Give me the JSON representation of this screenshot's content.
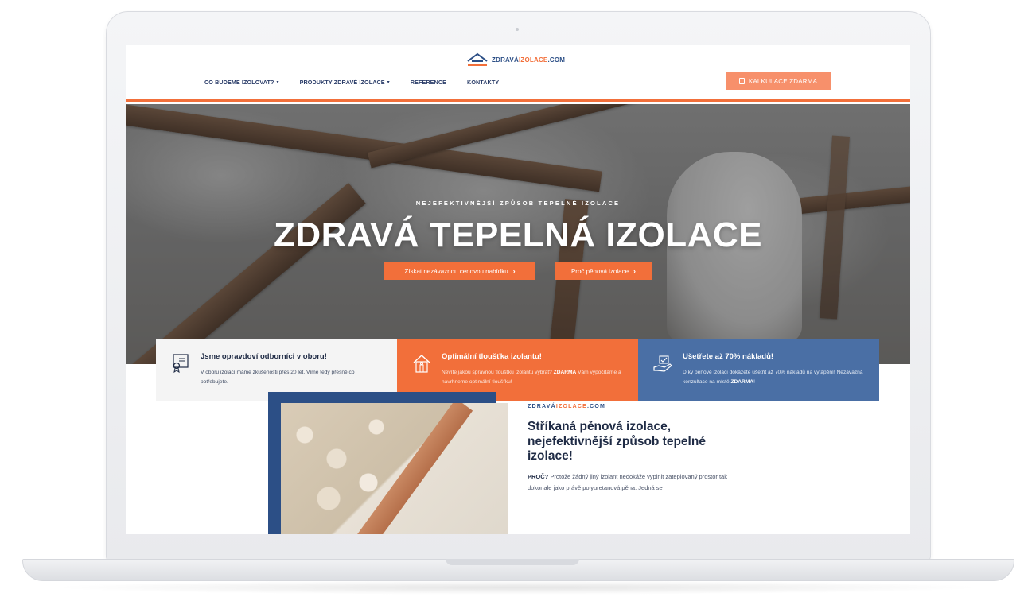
{
  "header": {
    "logo": {
      "part1": "ZDRAVÁ",
      "part2": "IZOLACE",
      "part3": ".COM"
    },
    "nav": [
      {
        "label": "CO BUDEME IZOLOVAT?",
        "has_dropdown": true
      },
      {
        "label": "PRODUKTY ZDRAVÉ IZOLACE",
        "has_dropdown": true
      },
      {
        "label": "REFERENCE",
        "has_dropdown": false
      },
      {
        "label": "KONTAKTY",
        "has_dropdown": false
      }
    ],
    "cta_label": "KALKULACE ZDARMA"
  },
  "hero": {
    "kicker": "NEJEFEKTIVNĚJŠÍ ZPŮSOB TEPELNÉ IZOLACE",
    "title": "ZDRAVÁ TEPELNÁ IZOLACE",
    "buttons": [
      {
        "label": "Získat nezávaznou cenovou nabídku",
        "arrow": "›"
      },
      {
        "label": "Proč pěnová izolace",
        "arrow": "›"
      }
    ]
  },
  "features": [
    {
      "title": "Jsme opravdoví odborníci v oboru!",
      "text": "V oboru izolací máme zkušenosti přes 20 let. Víme tedy přesně co potřebujete.",
      "icon": "certificate-icon"
    },
    {
      "title": "Optimální tloušťka izolantu!",
      "text_before": "Nevíte jakou správnou tloušťku izolantu vybrat?",
      "text_bold": "ZDARMA",
      "text_after": "Vám vypočítáme a navrhneme optimální tloušťku!",
      "icon": "house-icon"
    },
    {
      "title": "Ušetřete až 70% nákladů!",
      "text_before": "Díky pěnové izolaci dokážete ušetřit až 70% nákladů na vytápění! Nezávazná konzultace na místě",
      "text_bold": "ZDARMA",
      "text_after": "!",
      "icon": "savings-hand-icon"
    }
  ],
  "content": {
    "brand": {
      "part1": "ZDRAVÁ",
      "part2": "IZOLACE",
      "part3": ".COM"
    },
    "title": "Stříkaná pěnová izolace, nejefektivnější způsob tepelné izolace!",
    "text_bold": "PROČ?",
    "text": "Protože žádný jiný izolant nedokáže vyplnit zateplovaný prostor tak dokonale jako právě polyuretanová pěna. Jedná se"
  },
  "colors": {
    "accent_orange": "#f26f3a",
    "brand_blue": "#2c4f86",
    "feature_blue": "#4a6fa5",
    "cta_light_orange": "#f7906b"
  }
}
